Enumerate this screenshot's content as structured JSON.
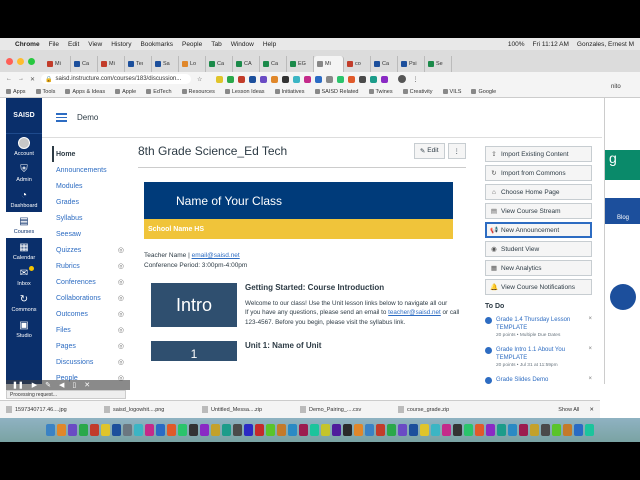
{
  "menubar": {
    "app": "Chrome",
    "items": [
      "File",
      "Edit",
      "View",
      "History",
      "Bookmarks",
      "People",
      "Tab",
      "Window",
      "Help"
    ],
    "battery": "100%",
    "clock": "Fri 11:12 AM",
    "user": "Gonzales, Ernest M"
  },
  "tabs": [
    {
      "label": "Mi",
      "color": "#c23c2a"
    },
    {
      "label": "Ca",
      "color": "#1c4f9c"
    },
    {
      "label": "Mi",
      "color": "#c23c2a"
    },
    {
      "label": "Teı",
      "color": "#1c4f9c"
    },
    {
      "label": "Sa",
      "color": "#1c4f9c"
    },
    {
      "label": "Lo",
      "color": "#e0872a"
    },
    {
      "label": "Ca",
      "color": "#1b8a4a"
    },
    {
      "label": "CA",
      "color": "#1b8a4a"
    },
    {
      "label": "Ca",
      "color": "#1b8a4a"
    },
    {
      "label": "EG",
      "color": "#1b8a4a"
    },
    {
      "label": "Mi",
      "color": "#888888",
      "active": true
    },
    {
      "label": "co",
      "color": "#c23c2a"
    },
    {
      "label": "Ca",
      "color": "#1c4f9c"
    },
    {
      "label": "Psi",
      "color": "#1c4f9c"
    },
    {
      "label": "Se",
      "color": "#1b8a4a"
    }
  ],
  "toolbar": {
    "url": "saisd.instructure.com/courses/183/discussion..."
  },
  "bookmarks": [
    "Apps",
    "Tools",
    "Apps & Ideas",
    "Apple",
    "EdTech",
    "Resources",
    "Lesson Ideas",
    "Initiatives",
    "SAISD Related",
    "Twines",
    "Creativity",
    "VILS",
    "Google"
  ],
  "globalnav": {
    "logo": "SAISD",
    "items": [
      {
        "label": "Account",
        "icon": "avatar"
      },
      {
        "label": "Admin",
        "icon": "shield-icon",
        "glyph": "⛨"
      },
      {
        "label": "Dashboard",
        "icon": "dashboard-icon",
        "glyph": "◔"
      },
      {
        "label": "Courses",
        "icon": "book-icon",
        "glyph": "▤",
        "active": true
      },
      {
        "label": "Calendar",
        "icon": "calendar-icon",
        "glyph": "▦"
      },
      {
        "label": "Inbox",
        "icon": "inbox-icon",
        "glyph": "✉"
      },
      {
        "label": "Commons",
        "icon": "commons-icon",
        "glyph": "↻"
      },
      {
        "label": "Studio",
        "icon": "studio-icon",
        "glyph": "▣"
      }
    ]
  },
  "course": {
    "breadcrumb": "Demo",
    "title": "8th Grade Science_Ed Tech",
    "edit_label": "Edit",
    "more_label": "⋮"
  },
  "coursenav": [
    {
      "label": "Home",
      "active": true,
      "hidden": false
    },
    {
      "label": "Announcements",
      "hidden": false
    },
    {
      "label": "Modules",
      "hidden": false
    },
    {
      "label": "Grades",
      "hidden": false
    },
    {
      "label": "Syllabus",
      "hidden": false
    },
    {
      "label": "Seesaw",
      "hidden": false
    },
    {
      "label": "Quizzes",
      "hidden": true
    },
    {
      "label": "Rubrics",
      "hidden": true
    },
    {
      "label": "Conferences",
      "hidden": true
    },
    {
      "label": "Collaborations",
      "hidden": true
    },
    {
      "label": "Outcomes",
      "hidden": true
    },
    {
      "label": "Files",
      "hidden": true
    },
    {
      "label": "Pages",
      "hidden": true
    },
    {
      "label": "Discussions",
      "hidden": true
    },
    {
      "label": "People",
      "hidden": true
    }
  ],
  "banner": {
    "class_name": "Name of Your Class",
    "school_name": "School Name HS"
  },
  "teacher": {
    "prefix": "Teacher Name | ",
    "email": "email@saisd.net",
    "period": "Conference Period: 3:00pm-4:00pm"
  },
  "intro": {
    "image_label": "Intro",
    "heading": "Getting Started: Course Introduction",
    "line1": "Welcome to our class! Use the Unit lesson links below to navigate all our",
    "line2_prefix": "If you have any questions, please send an email to ",
    "line2_link": "teacher@saisd.net",
    "line2_suffix": " or call",
    "line3": "123-4567. Before you begin, please visit the syllabus link."
  },
  "unit1": {
    "image_label": "1",
    "heading": "Unit 1: Name of Unit"
  },
  "sidebar_buttons": [
    {
      "label": "Import Existing Content",
      "glyph": "⇪"
    },
    {
      "label": "Import from Commons",
      "glyph": "↻"
    },
    {
      "label": "Choose Home Page",
      "glyph": "⌂"
    },
    {
      "label": "View Course Stream",
      "glyph": "▤"
    },
    {
      "label": "New Announcement",
      "glyph": "📢",
      "focused": true
    },
    {
      "label": "Student View",
      "glyph": "◉"
    },
    {
      "label": "New Analytics",
      "glyph": "▦"
    },
    {
      "label": "View Course Notifications",
      "glyph": "🔔"
    }
  ],
  "todo": {
    "title": "To Do",
    "items": [
      {
        "title": "Grade 1.4 Thursday Lesson TEMPLATE",
        "meta": "20 points • Multiple Due Dates"
      },
      {
        "title": "Grade Intro 1.1 About You TEMPLATE",
        "meta": "20 points • Jul 31 at 11:59pm"
      },
      {
        "title": "Grade Slides Demo",
        "meta": ""
      }
    ]
  },
  "rightwin": {
    "heading": "g",
    "blog_label": "Blog",
    "partial_label": "nito"
  },
  "status": "Processing request...",
  "downloads": {
    "items": [
      "1597340717.46....jpg",
      "saisd_logowhit....png",
      "Untitled_Messa....zip",
      "Demo_Pairing_....csv",
      "course_grade.zip"
    ],
    "show_all": "Show All",
    "close": "✕"
  },
  "dock_colors": [
    "#3b82c4",
    "#e0872a",
    "#6a4bc4",
    "#2aa84a",
    "#c23c2a",
    "#e0c42a",
    "#1c4f9c",
    "#6b7780",
    "#3bb5c4",
    "#c42a8a",
    "#2a6bc4",
    "#e05a2a",
    "#2ac46b",
    "#333333",
    "#8a2ac4",
    "#c4a12a",
    "#1c9c8a",
    "#4a4a4a",
    "#2a2ac4",
    "#c42a2a",
    "#5ac42a",
    "#c47a2a",
    "#2a8ac4",
    "#9c1c4f",
    "#1cc49c",
    "#c4c42a",
    "#4f1c9c",
    "#2a2a2a",
    "#e0872a",
    "#3b82c4",
    "#c23c2a",
    "#2aa84a",
    "#6a4bc4",
    "#1c4f9c",
    "#e0c42a",
    "#3bb5c4",
    "#c42a8a",
    "#333333",
    "#2ac46b",
    "#e05a2a",
    "#8a2ac4",
    "#1c9c8a",
    "#2a8ac4",
    "#9c1c4f",
    "#c4a12a",
    "#4a4a4a",
    "#5ac42a",
    "#c47a2a",
    "#2a6bc4",
    "#1cc49c"
  ]
}
